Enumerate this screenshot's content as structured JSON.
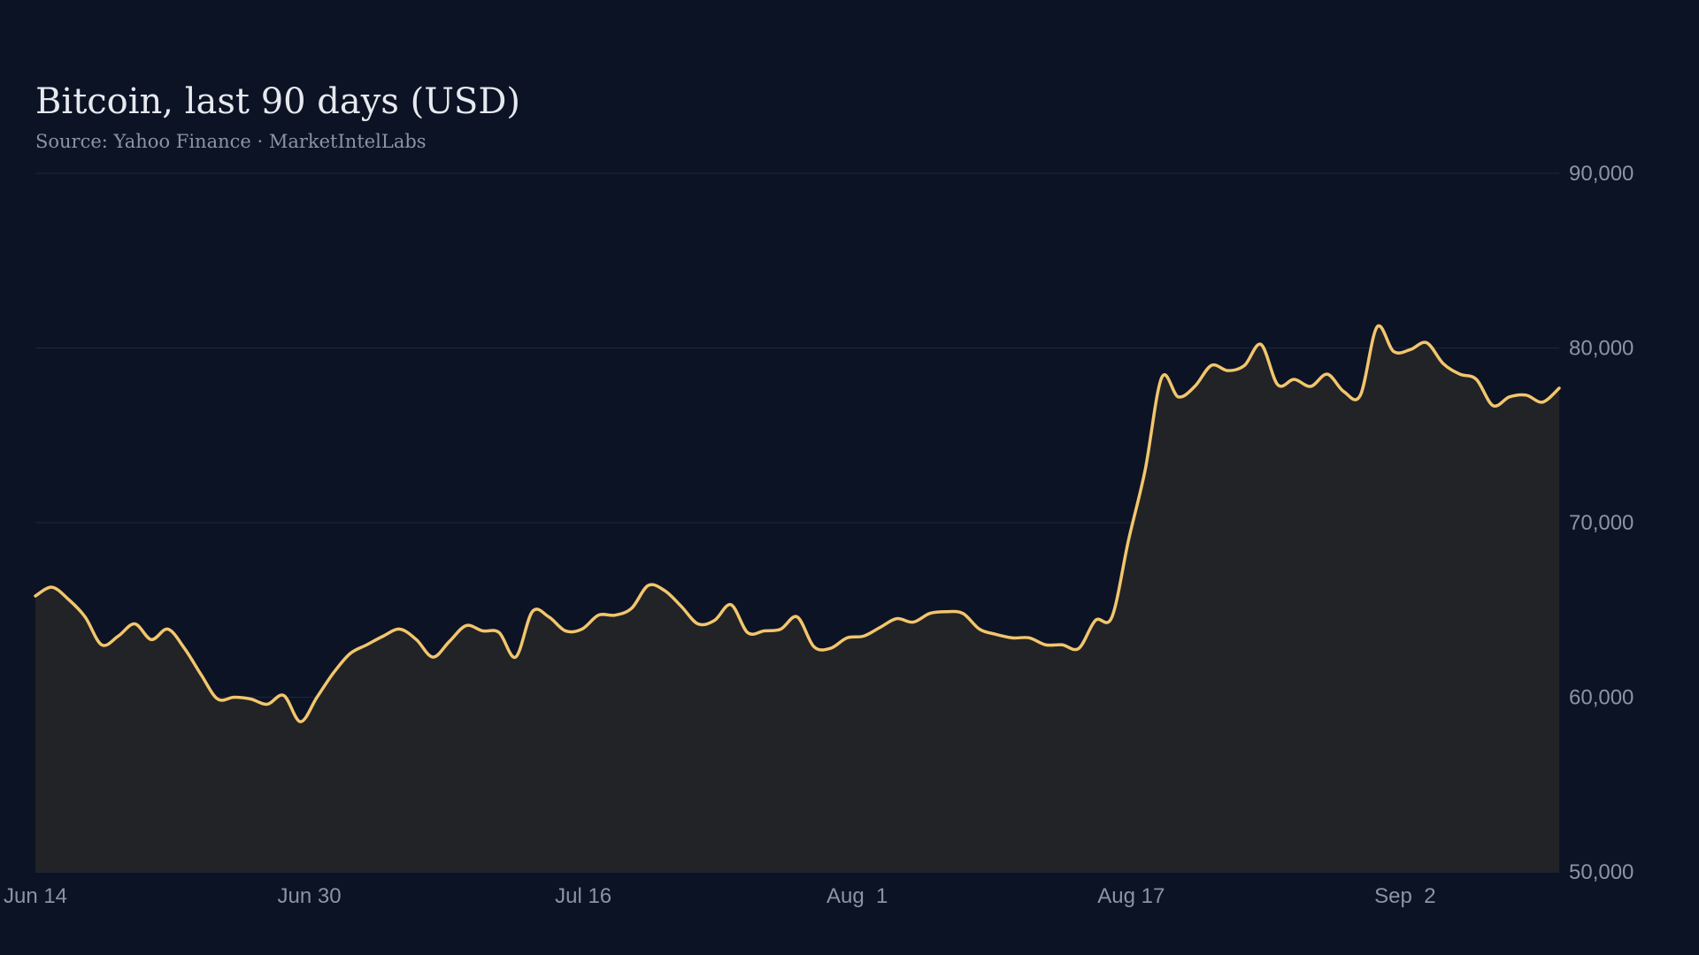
{
  "colors": {
    "background": "#0c1324",
    "line": "#f2c66d",
    "area": "#222326",
    "grid": "#1d2738",
    "text": "#e6e9ef",
    "muted": "#8c94a3"
  },
  "chart_data": {
    "type": "area",
    "title": "Bitcoin, last 90 days (USD)",
    "subtitle": "Source: Yahoo Finance · MarketIntelLabs",
    "xlabel": "",
    "ylabel": "",
    "x_start": "Jun 14",
    "x_end": "Sep 11",
    "ylim": [
      50000,
      90000
    ],
    "y_ticks": [
      50000,
      60000,
      70000,
      80000,
      90000
    ],
    "y_tick_labels": [
      "50,000",
      "60,000",
      "70,000",
      "80,000",
      "90,000"
    ],
    "x_ticks": [
      {
        "date": "Jun 14",
        "label": "Jun 14"
      },
      {
        "date": "Jun 30",
        "label": "Jun 30"
      },
      {
        "date": "Jul 16",
        "label": "Jul 16"
      },
      {
        "date": "Aug 1",
        "label": "Aug  1"
      },
      {
        "date": "Aug 17",
        "label": "Aug 17"
      },
      {
        "date": "Sep 2",
        "label": "Sep  2"
      }
    ],
    "grid": true,
    "legend": "none",
    "series": [
      {
        "values": [
          65800,
          66300,
          65600,
          64600,
          63000,
          63500,
          64200,
          63300,
          63900,
          62800,
          61300,
          59900,
          60000,
          59900,
          59600,
          60100,
          58600,
          60000,
          61400,
          62500,
          63000,
          63500,
          63900,
          63300,
          62300,
          63200,
          64100,
          63800,
          63700,
          62300,
          64900,
          64600,
          63800,
          63900,
          64700,
          64700,
          65100,
          66400,
          66100,
          65200,
          64200,
          64400,
          65300,
          63700,
          63800,
          63900,
          64600,
          62900,
          62800,
          63400,
          63500,
          64000,
          64500,
          64300,
          64800,
          64900,
          64800,
          63900,
          63600,
          63400,
          63400,
          63000,
          63000,
          62800,
          64400,
          64600,
          69000,
          73000,
          78300,
          77200,
          77800,
          79000,
          78700,
          79000,
          80200,
          77900,
          78200,
          77800,
          78500,
          77500,
          77300,
          81200,
          79800,
          79900,
          80300,
          79100,
          78500,
          78200,
          76700,
          77200,
          77300,
          76900,
          77700
        ]
      }
    ]
  }
}
